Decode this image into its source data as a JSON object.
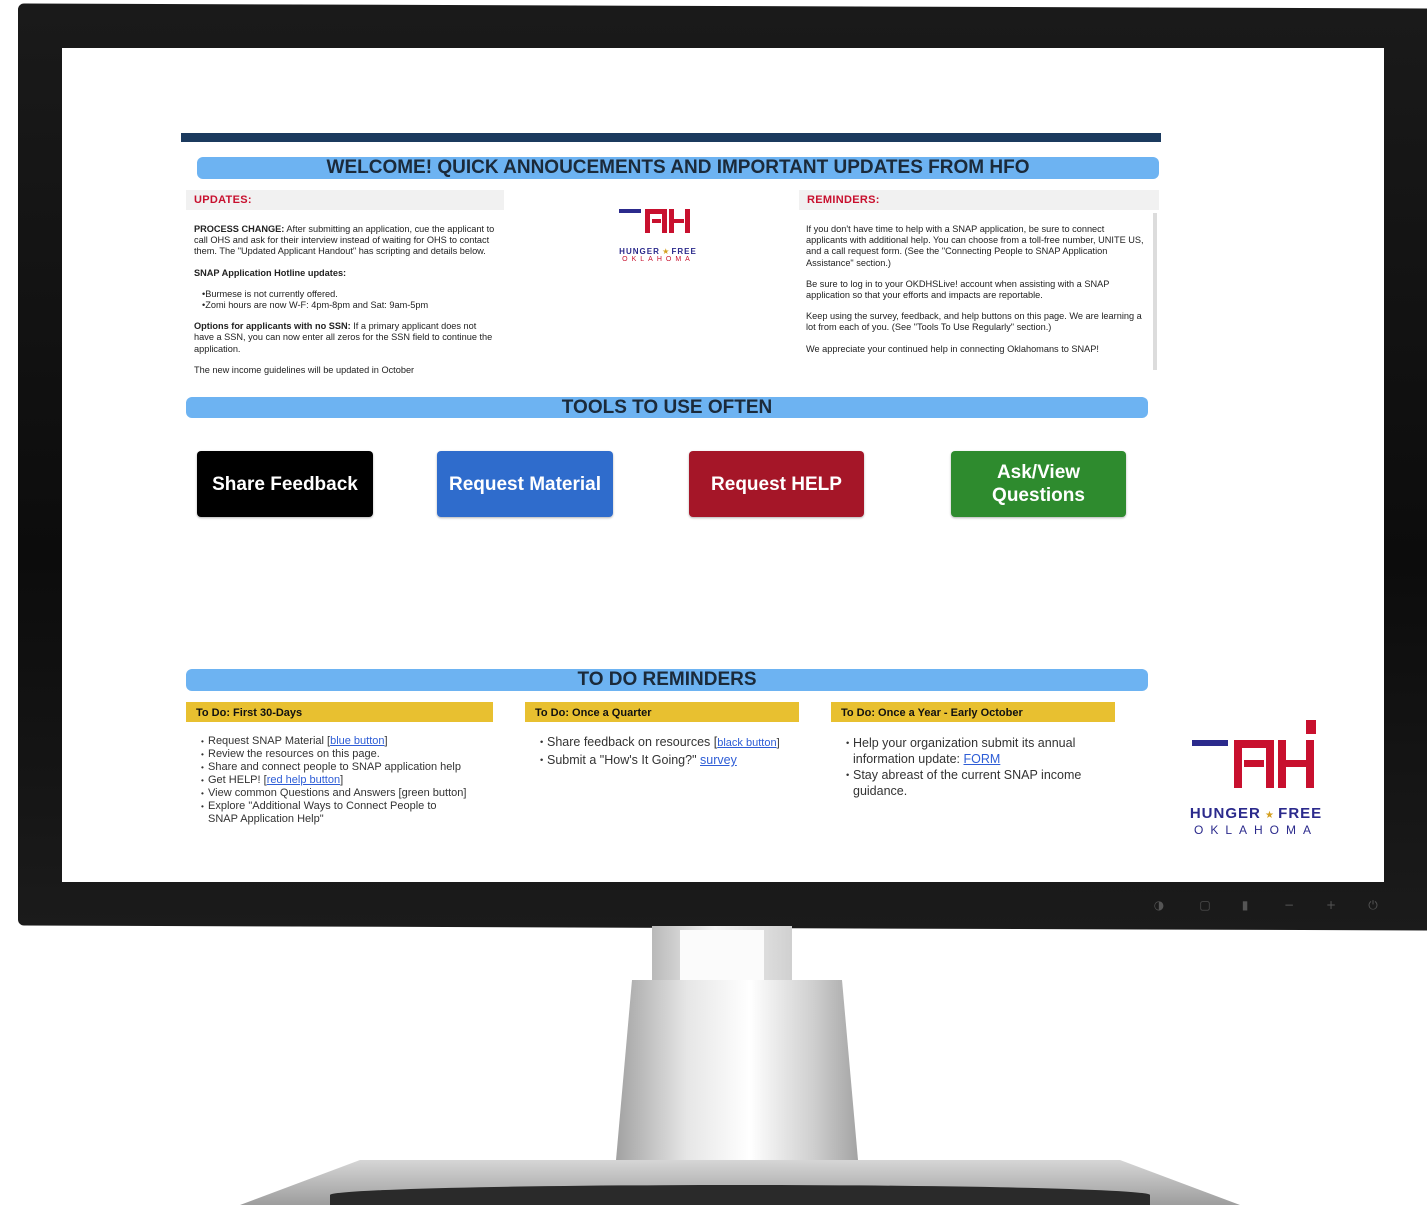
{
  "banners": {
    "welcome": "WELCOME! QUICK ANNOUCEMENTS AND IMPORTANT UPDATES FROM HFO",
    "tools": "TOOLS TO USE OFTEN",
    "todo": "TO DO REMINDERS"
  },
  "updates": {
    "heading": "UPDATES:",
    "p1_bold": "PROCESS CHANGE:",
    "p1_text": " After submitting an application, cue the applicant to call OHS and ask for their interview instead of waiting for OHS to contact them. The \"Updated Applicant Handout\" has scripting and details below.",
    "p2_bold": "SNAP Application Hotline updates:",
    "bullets": [
      "Burmese is not currently offered.",
      "Zomi hours are now W-F: 4pm-8pm and Sat: 9am-5pm"
    ],
    "p3_bold": "Options for applicants with no SSN:",
    "p3_text": " If a primary applicant does not have a SSN, you can now enter all zeros for the SSN field to continue the application.",
    "p4": "The new income guidelines will be updated in October"
  },
  "logo": {
    "word1": "HUNGER",
    "star": "★",
    "word2": "FREE",
    "sub": "OKLAHOMA"
  },
  "reminders": {
    "heading": "REMINDERS:",
    "paragraphs": [
      "If you don't have time to help with a SNAP application, be sure to connect applicants with additional help. You can choose from a toll-free number, UNITE US, and a call request form. (See the \"Connecting People to SNAP Application Assistance\" section.)",
      "Be sure to log in to your OKDHSLive! account when assisting with a SNAP application so that your efforts and impacts are reportable.",
      "Keep using the survey, feedback, and help buttons on this page. We are learning a lot from each of you. (See \"Tools To Use Regularly\" section.)",
      "We appreciate your continued help in connecting Oklahomans to SNAP!"
    ]
  },
  "buttons": {
    "feedback": "Share Feedback",
    "material": "Request Material",
    "help": "Request HELP",
    "questions_line1": "Ask/View",
    "questions_line2": "Questions"
  },
  "todo": {
    "col1": {
      "heading": "To Do: First 30-Days",
      "i1_text": "Request SNAP Material [",
      "i1_link": "blue button",
      "i1_end": "]",
      "i2": "Review the resources on this page.",
      "i3": "Share and connect people to SNAP application help",
      "i4_text": "Get HELP! [",
      "i4_link": "red help button",
      "i4_end": "]",
      "i5": "View common Questions and Answers [green button]",
      "i6": "Explore \"Additional Ways to Connect People to SNAP Application Help\""
    },
    "col2": {
      "heading": "To Do: Once a Quarter",
      "i1_text": "Share feedback on resources [",
      "i1_link": "black button",
      "i1_end": "]",
      "i2_text": "Submit a \"How's It Going?\" ",
      "i2_link": "survey"
    },
    "col3": {
      "heading": "To Do: Once a Year - Early October",
      "i1_text": "Help your organization submit its annual information update: ",
      "i1_link": "FORM",
      "i2": "Stay abreast of the current SNAP income guidance."
    }
  },
  "monitor_controls": [
    "◑",
    "▢",
    "▮",
    "−",
    "+",
    "⏻"
  ],
  "colors": {
    "banner": "#6db3f2",
    "topbar": "#1b3a5e",
    "feedback_button": "#000000",
    "material_button": "#2f6ccc",
    "help_button": "#a51628",
    "questions_button": "#2e8b2e",
    "todo_heading": "#e8c030",
    "section_heading_text": "#c8102e"
  }
}
